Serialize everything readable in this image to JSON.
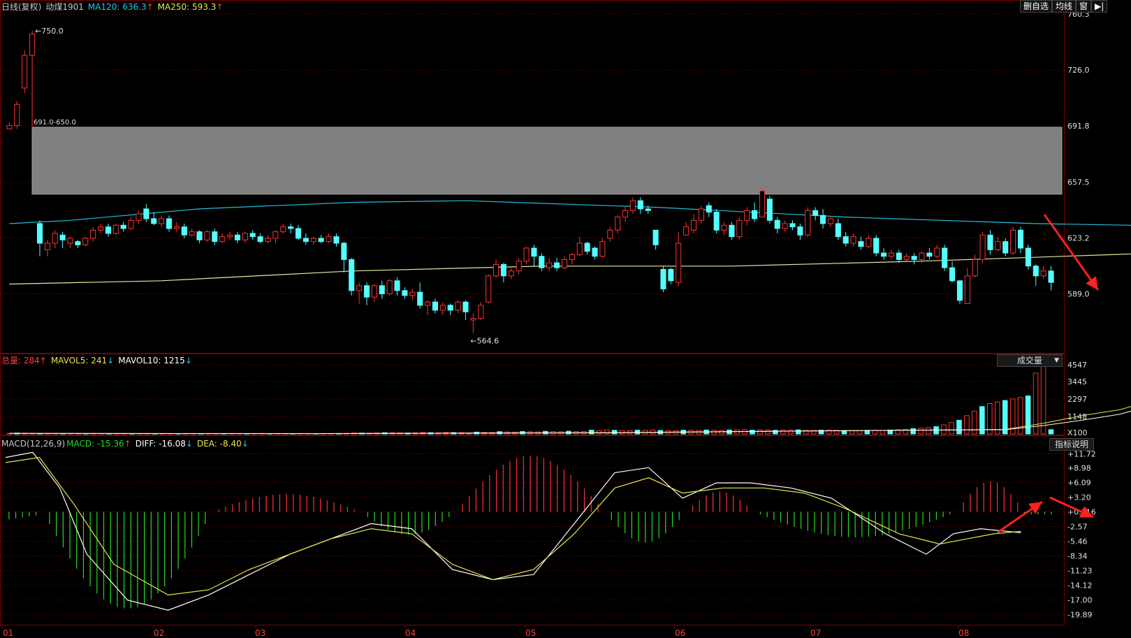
{
  "price_header": {
    "period": "日线(复权)",
    "symbol": "动煤1901",
    "ma120": "MA120: 636.3",
    "ma120_arrow": "↑",
    "ma250": "MA250: 593.3",
    "ma250_arrow": "↑"
  },
  "toolbar": {
    "delete_watch": "删自选",
    "ma_line": "均线",
    "window": "窗",
    "exit": "▶|"
  },
  "volume_header": {
    "total": "总量: 284",
    "total_arrow": "↑",
    "mavol5": "MAVOL5: 241",
    "mavol5_arrow": "↓",
    "mavol10": "MAVOL10: 1215",
    "mavol10_arrow": "↓"
  },
  "volume_dropdown": "成交量",
  "macd_header": {
    "name": "MACD(12,26,9)",
    "macd": "MACD: -15.36",
    "macd_arrow": "↑",
    "diff": "DIFF: -16.08",
    "diff_arrow": "↓",
    "dea": "DEA: -8.40",
    "dea_arrow": "↓"
  },
  "indicator_button": "指标说明",
  "chart_data": [
    {
      "type": "candlestick",
      "price_axis": [
        "760.3",
        "726.0",
        "691.8",
        "657.5",
        "623.2",
        "589.0"
      ],
      "ylim": [
        555,
        760.3
      ],
      "annotations": {
        "high": "750.0",
        "low": "564.6",
        "zone": "691.0-650.0"
      },
      "zone": [
        650.0,
        691.0
      ],
      "ma120_curve": [
        [
          0,
          632
        ],
        [
          8,
          634
        ],
        [
          25,
          641
        ],
        [
          45,
          645
        ],
        [
          60,
          646
        ],
        [
          85,
          642
        ],
        [
          110,
          636
        ],
        [
          135,
          632
        ],
        [
          160,
          630
        ],
        [
          185,
          629
        ],
        [
          200,
          621
        ],
        [
          230,
          618
        ],
        [
          245,
          608
        ]
      ],
      "ma250_curve": [
        [
          0,
          595
        ],
        [
          20,
          597
        ],
        [
          45,
          603
        ],
        [
          70,
          606
        ],
        [
          95,
          606
        ],
        [
          120,
          609
        ],
        [
          145,
          613
        ],
        [
          170,
          617
        ],
        [
          185,
          620
        ],
        [
          200,
          621
        ],
        [
          220,
          622
        ],
        [
          245,
          622
        ]
      ],
      "candles": [
        [
          0,
          690,
          692,
          690,
          694
        ],
        [
          1,
          692,
          705,
          690,
          707
        ],
        [
          2,
          715,
          735,
          712,
          738
        ],
        [
          3,
          735,
          748,
          690,
          750
        ],
        [
          4,
          632,
          620,
          612,
          634
        ],
        [
          5,
          616,
          620,
          612,
          622
        ],
        [
          6,
          620,
          626,
          617,
          628
        ],
        [
          7,
          625,
          622,
          617,
          627
        ],
        [
          8,
          620,
          623,
          617,
          624
        ],
        [
          9,
          621,
          619,
          617,
          622
        ],
        [
          10,
          619,
          623,
          618,
          624
        ],
        [
          11,
          623,
          628,
          621,
          630
        ],
        [
          12,
          628,
          630,
          626,
          632
        ],
        [
          13,
          630,
          626,
          624,
          632
        ],
        [
          14,
          626,
          631,
          625,
          632
        ],
        [
          15,
          631,
          629,
          627,
          633
        ],
        [
          16,
          629,
          634,
          628,
          636
        ],
        [
          17,
          634,
          638,
          632,
          640
        ],
        [
          18,
          641,
          635,
          633,
          644
        ],
        [
          19,
          635,
          632,
          631,
          639
        ],
        [
          20,
          632,
          635,
          630,
          637
        ],
        [
          21,
          635,
          629,
          627,
          637
        ],
        [
          22,
          629,
          630,
          627,
          633
        ],
        [
          23,
          630,
          625,
          623,
          632
        ],
        [
          24,
          625,
          627,
          624,
          629
        ],
        [
          25,
          627,
          622,
          620,
          628
        ],
        [
          26,
          622,
          627,
          621,
          628
        ],
        [
          27,
          627,
          621,
          619,
          629
        ],
        [
          28,
          621,
          624,
          620,
          626
        ],
        [
          29,
          624,
          625,
          622,
          627
        ],
        [
          30,
          625,
          622,
          620,
          627
        ],
        [
          31,
          622,
          626,
          620,
          627
        ],
        [
          32,
          626,
          624,
          622,
          628
        ],
        [
          33,
          624,
          621,
          620,
          626
        ],
        [
          34,
          621,
          623,
          620,
          625
        ],
        [
          35,
          623,
          627,
          620,
          628
        ],
        [
          36,
          627,
          630,
          626,
          632
        ],
        [
          37,
          630,
          629,
          626,
          632
        ],
        [
          38,
          629,
          623,
          622,
          631
        ],
        [
          39,
          623,
          621,
          619,
          626
        ],
        [
          40,
          621,
          623,
          619,
          624
        ],
        [
          41,
          623,
          621,
          620,
          625
        ],
        [
          42,
          621,
          624,
          620,
          626
        ],
        [
          43,
          624,
          620,
          618,
          626
        ],
        [
          44,
          620,
          610,
          602,
          621
        ],
        [
          45,
          610,
          591,
          588,
          611
        ],
        [
          46,
          591,
          594,
          583,
          596
        ],
        [
          47,
          594,
          587,
          582,
          596
        ],
        [
          48,
          587,
          594,
          584,
          595
        ],
        [
          49,
          594,
          589,
          586,
          597
        ],
        [
          50,
          589,
          597,
          588,
          598
        ],
        [
          51,
          597,
          591,
          588,
          599
        ],
        [
          52,
          591,
          588,
          586,
          593
        ],
        [
          53,
          588,
          590,
          585,
          592
        ],
        [
          54,
          590,
          582,
          580,
          596
        ],
        [
          55,
          582,
          584,
          576,
          585
        ],
        [
          56,
          584,
          579,
          577,
          586
        ],
        [
          57,
          579,
          582,
          576,
          584
        ],
        [
          58,
          582,
          579,
          576,
          583
        ],
        [
          59,
          579,
          584,
          577,
          585
        ],
        [
          60,
          584,
          578,
          573,
          585
        ],
        [
          61,
          573,
          574,
          565,
          577
        ],
        [
          62,
          574,
          582,
          573,
          584
        ],
        [
          63,
          584,
          600,
          583,
          601
        ],
        [
          64,
          600,
          607,
          599,
          610
        ],
        [
          65,
          607,
          600,
          596,
          608
        ],
        [
          66,
          600,
          603,
          598,
          605
        ],
        [
          67,
          603,
          609,
          601,
          611
        ],
        [
          68,
          609,
          617,
          607,
          618
        ],
        [
          69,
          617,
          612,
          606,
          619
        ],
        [
          70,
          612,
          605,
          603,
          614
        ],
        [
          71,
          605,
          608,
          603,
          611
        ],
        [
          72,
          608,
          605,
          603,
          611
        ],
        [
          73,
          605,
          610,
          604,
          612
        ],
        [
          74,
          610,
          613,
          607,
          614
        ],
        [
          75,
          613,
          620,
          612,
          624
        ],
        [
          76,
          620,
          615,
          613,
          621
        ],
        [
          77,
          617,
          612,
          610,
          618
        ],
        [
          78,
          612,
          621,
          611,
          623
        ],
        [
          79,
          623,
          628,
          621,
          630
        ],
        [
          80,
          628,
          636,
          626,
          637
        ],
        [
          81,
          636,
          640,
          633,
          643
        ],
        [
          82,
          640,
          646,
          638,
          648
        ],
        [
          83,
          646,
          641,
          638,
          648
        ],
        [
          84,
          641,
          640,
          638,
          643
        ],
        [
          85,
          628,
          619,
          616,
          628
        ],
        [
          86,
          604,
          592,
          590,
          606
        ],
        [
          87,
          604,
          597,
          595,
          605
        ],
        [
          88,
          596,
          620,
          594,
          627
        ],
        [
          89,
          625,
          630,
          627,
          633
        ],
        [
          90,
          628,
          634,
          626,
          638
        ],
        [
          91,
          634,
          641,
          632,
          643
        ],
        [
          92,
          643,
          639,
          636,
          645
        ],
        [
          93,
          639,
          628,
          626,
          641
        ],
        [
          94,
          628,
          631,
          625,
          633
        ],
        [
          95,
          631,
          624,
          622,
          633
        ],
        [
          96,
          624,
          634,
          622,
          636
        ],
        [
          97,
          634,
          640,
          631,
          642
        ],
        [
          98,
          640,
          635,
          633,
          645
        ],
        [
          99,
          636,
          652,
          636,
          654
        ],
        [
          100,
          647,
          634,
          632,
          649
        ],
        [
          101,
          634,
          629,
          626,
          636
        ],
        [
          102,
          629,
          632,
          627,
          634
        ],
        [
          103,
          632,
          630,
          628,
          634
        ],
        [
          104,
          630,
          625,
          622,
          632
        ],
        [
          105,
          625,
          640,
          624,
          642
        ],
        [
          106,
          640,
          637,
          634,
          642
        ],
        [
          107,
          637,
          632,
          629,
          641
        ],
        [
          108,
          632,
          635,
          630,
          636
        ],
        [
          109,
          632,
          624,
          622,
          635
        ],
        [
          110,
          624,
          620,
          618,
          627
        ],
        [
          111,
          620,
          624,
          618,
          626
        ],
        [
          112,
          621,
          618,
          616,
          624
        ],
        [
          113,
          618,
          623,
          617,
          625
        ],
        [
          114,
          623,
          614,
          612,
          625
        ],
        [
          115,
          614,
          612,
          610,
          617
        ],
        [
          116,
          612,
          614,
          610,
          616
        ],
        [
          117,
          614,
          610,
          608,
          616
        ],
        [
          118,
          610,
          612,
          609,
          614
        ],
        [
          119,
          612,
          610,
          607,
          614
        ],
        [
          120,
          610,
          614,
          608,
          615
        ],
        [
          121,
          614,
          612,
          610,
          617
        ],
        [
          122,
          612,
          617,
          611,
          619
        ],
        [
          123,
          617,
          605,
          603,
          619
        ],
        [
          124,
          605,
          597,
          596,
          609
        ],
        [
          125,
          597,
          585,
          583,
          597
        ],
        [
          126,
          583,
          600,
          583,
          605
        ],
        [
          127,
          600,
          610,
          599,
          613
        ],
        [
          128,
          610,
          625,
          608,
          627
        ],
        [
          129,
          625,
          616,
          613,
          628
        ],
        [
          130,
          616,
          621,
          615,
          624
        ],
        [
          131,
          621,
          614,
          612,
          623
        ],
        [
          132,
          614,
          628,
          613,
          630
        ],
        [
          133,
          628,
          617,
          614,
          630
        ],
        [
          134,
          617,
          606,
          604,
          619
        ],
        [
          135,
          606,
          600,
          594,
          607
        ],
        [
          136,
          600,
          603,
          598,
          606
        ],
        [
          137,
          603,
          596,
          591,
          606
        ]
      ]
    },
    {
      "type": "bar",
      "series_name": "成交量",
      "volume_axis": [
        "4547",
        "3445",
        "2297",
        "1148",
        "X100"
      ],
      "ylim": [
        0,
        4547
      ],
      "values": [
        40,
        60,
        50,
        30,
        20,
        15,
        18,
        20,
        15,
        12,
        14,
        18,
        16,
        12,
        15,
        13,
        16,
        20,
        18,
        15,
        13,
        12,
        14,
        12,
        15,
        14,
        12,
        13,
        14,
        12,
        15,
        13,
        12,
        14,
        13,
        12,
        14,
        16,
        14,
        12,
        13,
        15,
        16,
        30,
        40,
        60,
        55,
        50,
        60,
        80,
        70,
        65,
        60,
        70,
        90,
        80,
        70,
        100,
        90,
        80,
        70,
        120,
        100,
        90,
        150,
        140,
        130,
        160,
        150,
        140,
        170,
        160,
        150,
        180,
        160,
        170,
        250,
        220,
        260,
        240,
        230,
        220,
        250,
        240,
        260,
        230,
        220,
        210,
        250,
        240,
        230,
        260,
        250,
        240,
        260,
        270,
        280,
        250,
        270,
        260,
        240,
        260,
        250,
        270,
        240,
        230,
        250,
        260,
        240,
        230,
        220,
        210,
        240,
        250,
        230,
        260,
        280,
        300,
        350,
        380,
        420,
        480,
        600,
        750,
        900,
        1200,
        1500,
        1800,
        2000,
        2100,
        2200,
        2300,
        2400,
        2500,
        4000,
        4547,
        284
      ],
      "mavol5": [
        [
          0,
          30
        ],
        [
          40,
          20
        ],
        [
          80,
          80
        ],
        [
          110,
          220
        ],
        [
          130,
          300
        ],
        [
          135,
          700
        ],
        [
          140,
          1200
        ],
        [
          145,
          1600
        ],
        [
          150,
          2300
        ],
        [
          155,
          3500
        ]
      ],
      "mavol10": [
        [
          0,
          40
        ],
        [
          40,
          25
        ],
        [
          80,
          90
        ],
        [
          110,
          220
        ],
        [
          130,
          280
        ],
        [
          135,
          550
        ],
        [
          140,
          900
        ],
        [
          145,
          1300
        ],
        [
          150,
          2000
        ],
        [
          155,
          3000
        ]
      ]
    },
    {
      "type": "histogram_line",
      "series": [
        "MACD",
        "DIFF",
        "DEA"
      ],
      "macd_axis": [
        "+11.72",
        "+8.98",
        "+6.09",
        "+3.20",
        "+0.316",
        "-2.57",
        "-5.46",
        "-8.34",
        "-11.23",
        "-14.12",
        "-17.00",
        "-19.89"
      ],
      "ylim": [
        -21.3,
        13.0
      ]
    }
  ],
  "x_axis": [
    "01",
    "02",
    "03",
    "04",
    "05",
    "06",
    "07",
    "08"
  ]
}
